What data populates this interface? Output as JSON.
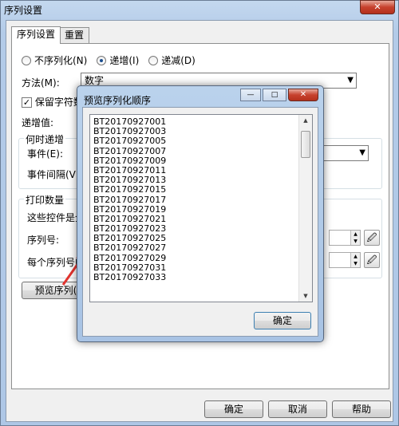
{
  "window": {
    "title": "序列设置",
    "close": "✕"
  },
  "tabs": [
    {
      "label": "序列设置"
    },
    {
      "label": "重置"
    }
  ],
  "mode": {
    "options": [
      {
        "label": "不序列化(N)"
      },
      {
        "label": "递增(I)"
      },
      {
        "label": "递减(D)"
      }
    ],
    "selected": "递增(I)"
  },
  "method": {
    "label": "方法(M):",
    "value": "数字"
  },
  "keep_chars": {
    "label": "保留字符数"
  },
  "increment": {
    "label": "递增值:"
  },
  "when_group": {
    "title": "何时递增",
    "event_label": "事件(E):",
    "interval_label": "事件间隔(V):"
  },
  "print_group": {
    "title": "打印数量",
    "note": "这些控件是全",
    "serial_label": "序列号:",
    "per_serial_label": "每个序列号的"
  },
  "preview_button": {
    "label": "预览序列("
  },
  "footer": {
    "ok": "确定",
    "cancel": "取消",
    "help": "帮助"
  },
  "dialog": {
    "title": "预览序列化顺序",
    "items": [
      "BT20170927001",
      "BT20170927003",
      "BT20170927005",
      "BT20170927007",
      "BT20170927009",
      "BT20170927011",
      "BT20170927013",
      "BT20170927015",
      "BT20170927017",
      "BT20170927019",
      "BT20170927021",
      "BT20170927023",
      "BT20170927025",
      "BT20170927027",
      "BT20170927029",
      "BT20170927031",
      "BT20170927033"
    ],
    "ok": "确定",
    "minimize": "—",
    "maximize": "□",
    "close": "✕"
  },
  "colors": {
    "arrow": "#e3342f",
    "accent": "#1a4d8f"
  }
}
